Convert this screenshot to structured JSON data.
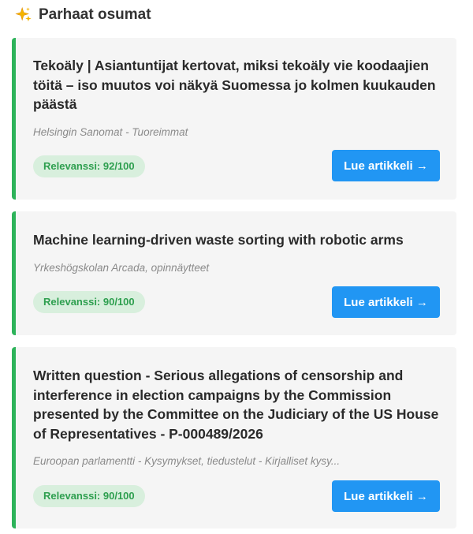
{
  "header": {
    "icon": "sparkles-icon",
    "title": "Parhaat osumat"
  },
  "results": [
    {
      "title": "Tekoäly | Asiantuntijat kertovat, miksi tekoäly vie koodaajien töitä – iso muutos voi näkyä Suomessa jo kolmen kuukauden päästä",
      "source": "Helsingin Sanomat - Tuoreimmat",
      "relevance": "Relevanssi: 92/100",
      "button": "Lue artikkeli →"
    },
    {
      "title": "Machine learning-driven waste sorting with robotic arms",
      "source": "Yrkeshögskolan Arcada, opinnäytteet",
      "relevance": "Relevanssi: 90/100",
      "button": "Lue artikkeli →"
    },
    {
      "title": "Written question - Serious allegations of censorship and interference in election campaigns by the Commission presented by the Committee on the Judiciary of the US House of Representatives - P-000489/2026",
      "source": "Euroopan parlamentti - Kysymykset, tiedustelut - Kirjalliset kysy...",
      "relevance": "Relevanssi: 90/100",
      "button": "Lue artikkeli →"
    }
  ],
  "colors": {
    "accent_border": "#2db35a",
    "button": "#2196f3",
    "badge_bg": "#d8efdd",
    "badge_text": "#2e9f4f",
    "card_bg": "#f5f5f5"
  }
}
